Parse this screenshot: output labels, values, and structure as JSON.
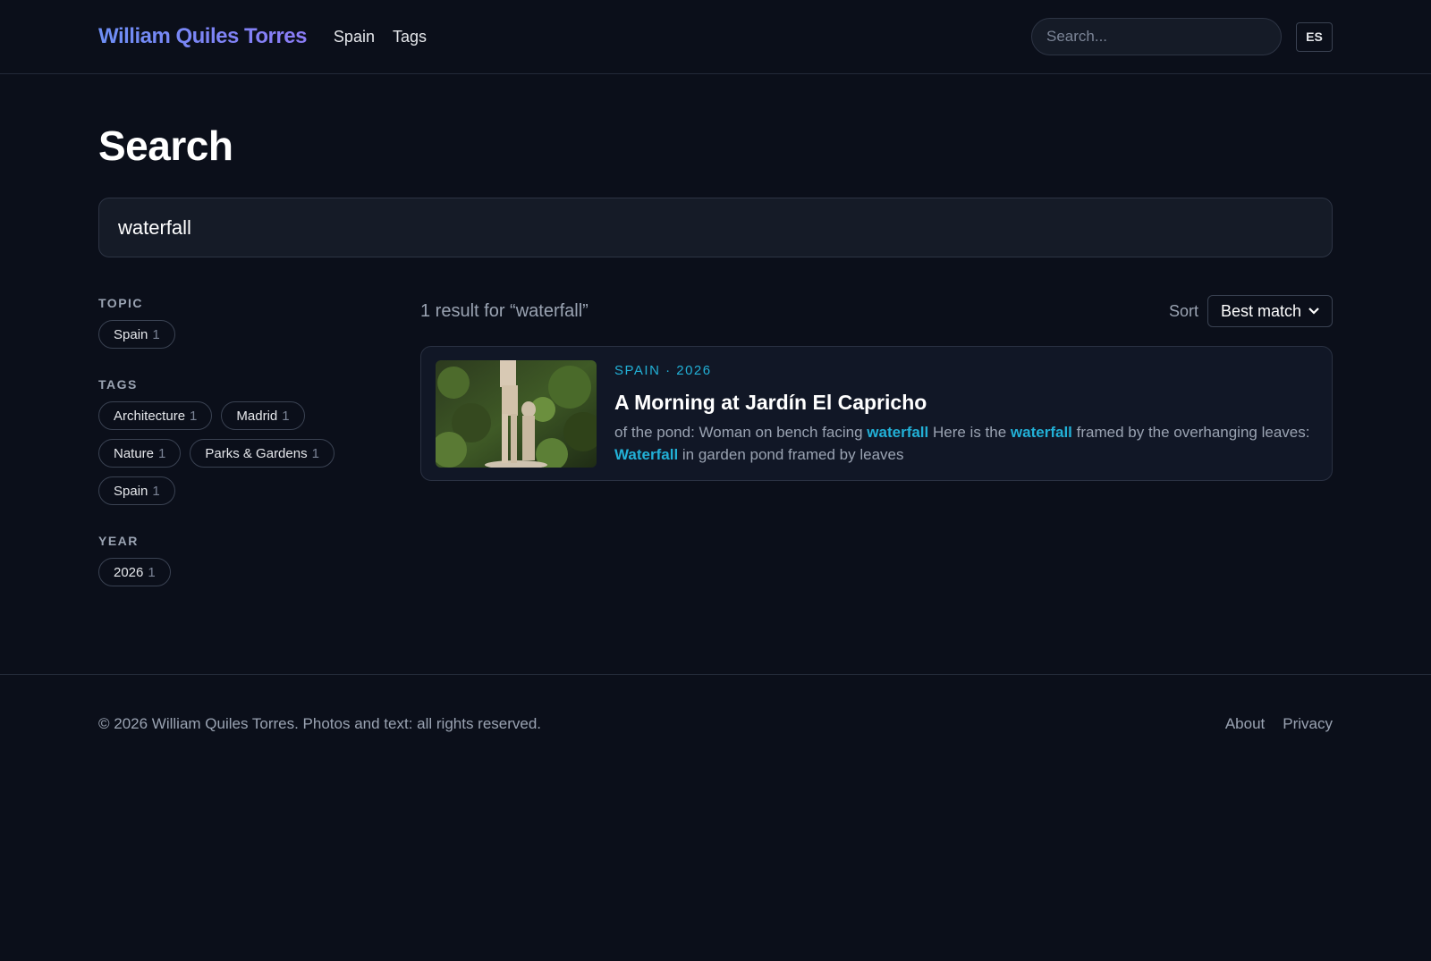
{
  "header": {
    "brand": "William Quiles Torres",
    "nav": [
      "Spain",
      "Tags"
    ],
    "search_placeholder": "Search...",
    "lang": "ES"
  },
  "main": {
    "title": "Search",
    "query": "waterfall"
  },
  "filters": {
    "topic": {
      "heading": "TOPIC",
      "items": [
        {
          "label": "Spain",
          "count": "1"
        }
      ]
    },
    "tags": {
      "heading": "TAGS",
      "items": [
        {
          "label": "Architecture",
          "count": "1"
        },
        {
          "label": "Madrid",
          "count": "1"
        },
        {
          "label": "Nature",
          "count": "1"
        },
        {
          "label": "Parks & Gardens",
          "count": "1"
        },
        {
          "label": "Spain",
          "count": "1"
        }
      ]
    },
    "year": {
      "heading": "YEAR",
      "items": [
        {
          "label": "2026",
          "count": "1"
        }
      ]
    }
  },
  "results": {
    "count_text": "1 result for “waterfall”",
    "sort_label": "Sort",
    "sort_value": "Best match",
    "items": [
      {
        "meta": "SPAIN · 2026",
        "title": "A Morning at Jardín El Capricho",
        "snippet_parts": [
          {
            "text": "of the pond: Woman on bench facing ",
            "hl": false
          },
          {
            "text": "waterfall",
            "hl": true
          },
          {
            "text": " Here is the ",
            "hl": false
          },
          {
            "text": "waterfall",
            "hl": true
          },
          {
            "text": " framed by the overhanging leaves: ",
            "hl": false
          },
          {
            "text": "Waterfall",
            "hl": true
          },
          {
            "text": " in garden pond framed by leaves",
            "hl": false
          }
        ]
      }
    ]
  },
  "footer": {
    "copyright": "© 2026 William Quiles Torres. Photos and text: all rights reserved.",
    "links": [
      "About",
      "Privacy"
    ]
  },
  "colors": {
    "background": "#0b0f1a",
    "accent": "#22b0d6",
    "brand_start": "#6d8ef5",
    "brand_end": "#8b7cf6"
  }
}
